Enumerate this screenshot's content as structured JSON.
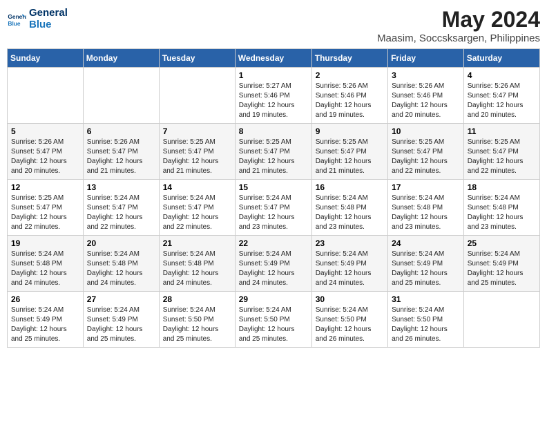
{
  "header": {
    "logo_line1": "General",
    "logo_line2": "Blue",
    "main_title": "May 2024",
    "subtitle": "Maasim, Soccsksargen, Philippines"
  },
  "days_of_week": [
    "Sunday",
    "Monday",
    "Tuesday",
    "Wednesday",
    "Thursday",
    "Friday",
    "Saturday"
  ],
  "weeks": [
    [
      {
        "day": "",
        "detail": ""
      },
      {
        "day": "",
        "detail": ""
      },
      {
        "day": "",
        "detail": ""
      },
      {
        "day": "1",
        "detail": "Sunrise: 5:27 AM\nSunset: 5:46 PM\nDaylight: 12 hours\nand 19 minutes."
      },
      {
        "day": "2",
        "detail": "Sunrise: 5:26 AM\nSunset: 5:46 PM\nDaylight: 12 hours\nand 19 minutes."
      },
      {
        "day": "3",
        "detail": "Sunrise: 5:26 AM\nSunset: 5:46 PM\nDaylight: 12 hours\nand 20 minutes."
      },
      {
        "day": "4",
        "detail": "Sunrise: 5:26 AM\nSunset: 5:47 PM\nDaylight: 12 hours\nand 20 minutes."
      }
    ],
    [
      {
        "day": "5",
        "detail": "Sunrise: 5:26 AM\nSunset: 5:47 PM\nDaylight: 12 hours\nand 20 minutes."
      },
      {
        "day": "6",
        "detail": "Sunrise: 5:26 AM\nSunset: 5:47 PM\nDaylight: 12 hours\nand 21 minutes."
      },
      {
        "day": "7",
        "detail": "Sunrise: 5:25 AM\nSunset: 5:47 PM\nDaylight: 12 hours\nand 21 minutes."
      },
      {
        "day": "8",
        "detail": "Sunrise: 5:25 AM\nSunset: 5:47 PM\nDaylight: 12 hours\nand 21 minutes."
      },
      {
        "day": "9",
        "detail": "Sunrise: 5:25 AM\nSunset: 5:47 PM\nDaylight: 12 hours\nand 21 minutes."
      },
      {
        "day": "10",
        "detail": "Sunrise: 5:25 AM\nSunset: 5:47 PM\nDaylight: 12 hours\nand 22 minutes."
      },
      {
        "day": "11",
        "detail": "Sunrise: 5:25 AM\nSunset: 5:47 PM\nDaylight: 12 hours\nand 22 minutes."
      }
    ],
    [
      {
        "day": "12",
        "detail": "Sunrise: 5:25 AM\nSunset: 5:47 PM\nDaylight: 12 hours\nand 22 minutes."
      },
      {
        "day": "13",
        "detail": "Sunrise: 5:24 AM\nSunset: 5:47 PM\nDaylight: 12 hours\nand 22 minutes."
      },
      {
        "day": "14",
        "detail": "Sunrise: 5:24 AM\nSunset: 5:47 PM\nDaylight: 12 hours\nand 22 minutes."
      },
      {
        "day": "15",
        "detail": "Sunrise: 5:24 AM\nSunset: 5:47 PM\nDaylight: 12 hours\nand 23 minutes."
      },
      {
        "day": "16",
        "detail": "Sunrise: 5:24 AM\nSunset: 5:48 PM\nDaylight: 12 hours\nand 23 minutes."
      },
      {
        "day": "17",
        "detail": "Sunrise: 5:24 AM\nSunset: 5:48 PM\nDaylight: 12 hours\nand 23 minutes."
      },
      {
        "day": "18",
        "detail": "Sunrise: 5:24 AM\nSunset: 5:48 PM\nDaylight: 12 hours\nand 23 minutes."
      }
    ],
    [
      {
        "day": "19",
        "detail": "Sunrise: 5:24 AM\nSunset: 5:48 PM\nDaylight: 12 hours\nand 24 minutes."
      },
      {
        "day": "20",
        "detail": "Sunrise: 5:24 AM\nSunset: 5:48 PM\nDaylight: 12 hours\nand 24 minutes."
      },
      {
        "day": "21",
        "detail": "Sunrise: 5:24 AM\nSunset: 5:48 PM\nDaylight: 12 hours\nand 24 minutes."
      },
      {
        "day": "22",
        "detail": "Sunrise: 5:24 AM\nSunset: 5:49 PM\nDaylight: 12 hours\nand 24 minutes."
      },
      {
        "day": "23",
        "detail": "Sunrise: 5:24 AM\nSunset: 5:49 PM\nDaylight: 12 hours\nand 24 minutes."
      },
      {
        "day": "24",
        "detail": "Sunrise: 5:24 AM\nSunset: 5:49 PM\nDaylight: 12 hours\nand 25 minutes."
      },
      {
        "day": "25",
        "detail": "Sunrise: 5:24 AM\nSunset: 5:49 PM\nDaylight: 12 hours\nand 25 minutes."
      }
    ],
    [
      {
        "day": "26",
        "detail": "Sunrise: 5:24 AM\nSunset: 5:49 PM\nDaylight: 12 hours\nand 25 minutes."
      },
      {
        "day": "27",
        "detail": "Sunrise: 5:24 AM\nSunset: 5:49 PM\nDaylight: 12 hours\nand 25 minutes."
      },
      {
        "day": "28",
        "detail": "Sunrise: 5:24 AM\nSunset: 5:50 PM\nDaylight: 12 hours\nand 25 minutes."
      },
      {
        "day": "29",
        "detail": "Sunrise: 5:24 AM\nSunset: 5:50 PM\nDaylight: 12 hours\nand 25 minutes."
      },
      {
        "day": "30",
        "detail": "Sunrise: 5:24 AM\nSunset: 5:50 PM\nDaylight: 12 hours\nand 26 minutes."
      },
      {
        "day": "31",
        "detail": "Sunrise: 5:24 AM\nSunset: 5:50 PM\nDaylight: 12 hours\nand 26 minutes."
      },
      {
        "day": "",
        "detail": ""
      }
    ]
  ]
}
